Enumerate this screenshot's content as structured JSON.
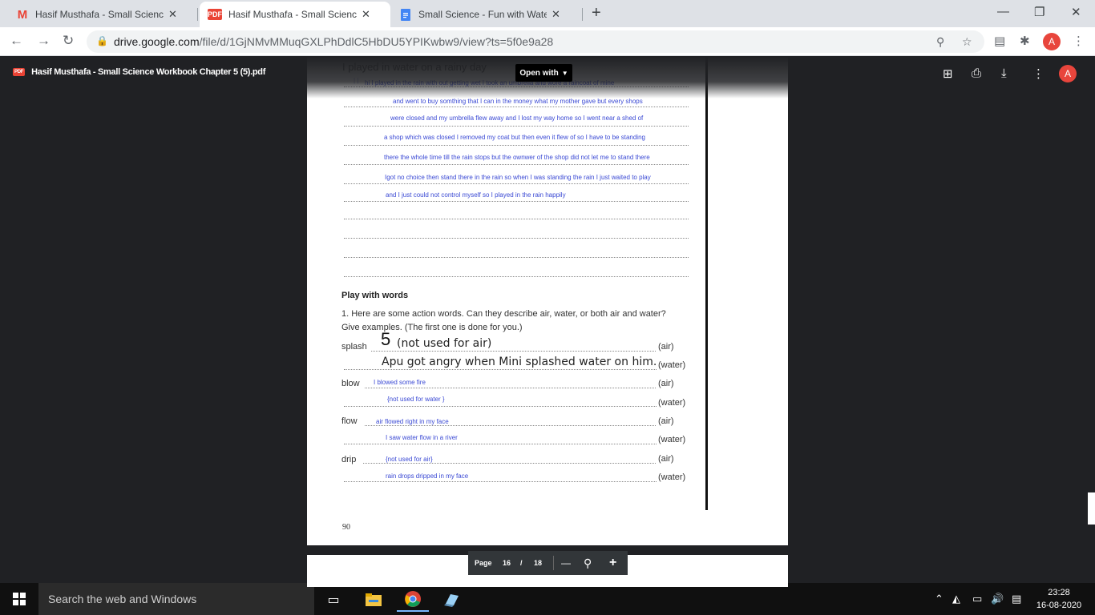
{
  "browser": {
    "tabs": [
      {
        "title": "Hasif Musthafa - Small Science W",
        "icon": "gmail-icon"
      },
      {
        "title": "Hasif Musthafa - Small Science W",
        "icon": "pdf-icon",
        "badge": "PDF"
      },
      {
        "title": "Small Science - Fun with Water -",
        "icon": "docs-icon"
      }
    ],
    "new_tab": "+",
    "url_host": "drive.google.com",
    "url_path": "/file/d/1GjNMvMMuqGXLPhDdlC5HbDU5YPIKwbw9/view?ts=5f0e9a28",
    "profile_initial": "A"
  },
  "viewer": {
    "file_badge": "PDF",
    "file_name": "Hasif Musthafa - Small Science Workbook Chapter 5 (5).pdf",
    "open_with": "Open with",
    "profile_initial": "A"
  },
  "pdf": {
    "heading": "I played in water on a rainy day",
    "marks": "| |",
    "story_lines": [
      "hi    I played in the rain with out getting wet I took an umbrella and wore a raincoat of mine",
      "and went to buy somthing    that I can in the money what my mother gave but every shops",
      "were closed and my umbrella flew away and I lost my way home so I went near a shed of",
      "a shop which was closed I    removed my coat but then even it flew of so I have to be standing",
      "there the whole time till the rain stops but the ownwer of the shop did not let me to stand there",
      "Igot no choice then stand there in the rain so when I was standing the rain I just waited to play",
      "and I just could not control myself so I played in the rain happily"
    ],
    "section_title": "Play with words",
    "question": "1. Here are some action words.  Can they describe air, water, or both air and water? Give examples. (The first one is done for you.)",
    "mark_5": "5",
    "rows": [
      {
        "word": "splash",
        "air_answer": "(not used for air)",
        "water_answer": "Apu got angry when Mini splashed water on him."
      },
      {
        "word": "blow",
        "air_answer": "I blowed some fire",
        "water_answer": "{not used for water }"
      },
      {
        "word": "flow",
        "air_answer": "air flowed right in my face",
        "water_answer": "I saw water flow in a river"
      },
      {
        "word": "drip",
        "air_answer": "{not used for air}",
        "water_answer": "rain drops dripped in my face"
      }
    ],
    "air_tag": "(air)",
    "water_tag": "(water)",
    "page_number": "90"
  },
  "pagenav": {
    "label": "Page",
    "current": "16",
    "sep": "/",
    "total": "18",
    "minus": "—",
    "plus": "+"
  },
  "taskbar": {
    "search_placeholder": "Search the web and Windows",
    "time": "23:28",
    "date": "16-08-2020"
  }
}
